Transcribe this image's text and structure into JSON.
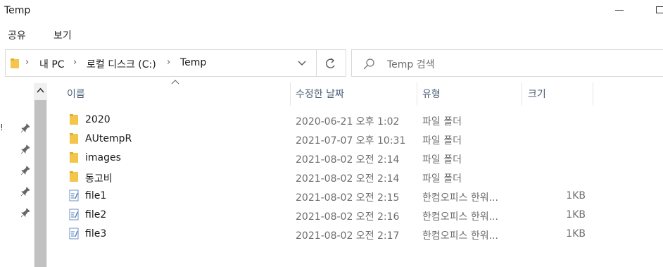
{
  "window": {
    "title": "Temp"
  },
  "ribbon": {
    "tabs": [
      "공유",
      "보기"
    ]
  },
  "address": {
    "crumbs": [
      "내 PC",
      "로컬 디스크 (C:)",
      "Temp"
    ]
  },
  "search": {
    "placeholder": "Temp 검색"
  },
  "columns": {
    "name": "이름",
    "date": "수정한 날짜",
    "type": "유형",
    "size": "크기"
  },
  "left_pane": {
    "edge_text": "!"
  },
  "files": [
    {
      "name": "2020",
      "date": "2020-06-21 오후 1:02",
      "type": "파일 폴더",
      "size": "",
      "icon": "folder-icon"
    },
    {
      "name": "AUtempR",
      "date": "2021-07-07 오후 10:31",
      "type": "파일 폴더",
      "size": "",
      "icon": "folder-icon"
    },
    {
      "name": "images",
      "date": "2021-08-02 오전 2:14",
      "type": "파일 폴더",
      "size": "",
      "icon": "folder-icon"
    },
    {
      "name": "동고비",
      "date": "2021-08-02 오전 2:14",
      "type": "파일 폴더",
      "size": "",
      "icon": "folder-icon"
    },
    {
      "name": "file1",
      "date": "2021-08-02 오전 2:15",
      "type": "한컴오피스 한워...",
      "size": "1KB",
      "icon": "document-icon"
    },
    {
      "name": "file2",
      "date": "2021-08-02 오전 2:16",
      "type": "한컴오피스 한워...",
      "size": "1KB",
      "icon": "document-icon"
    },
    {
      "name": "file3",
      "date": "2021-08-02 오전 2:17",
      "type": "한컴오피스 한워...",
      "size": "1KB",
      "icon": "document-icon"
    }
  ],
  "colors": {
    "folder": "#f3c54b",
    "header_text": "#4c607a",
    "doc_accent": "#4a78b8"
  }
}
